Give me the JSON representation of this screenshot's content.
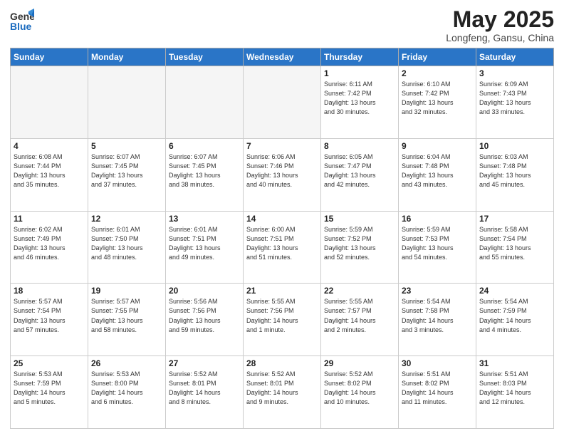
{
  "header": {
    "logo_general": "General",
    "logo_blue": "Blue",
    "month_title": "May 2025",
    "location": "Longfeng, Gansu, China"
  },
  "weekdays": [
    "Sunday",
    "Monday",
    "Tuesday",
    "Wednesday",
    "Thursday",
    "Friday",
    "Saturday"
  ],
  "weeks": [
    [
      {
        "day": "",
        "info": ""
      },
      {
        "day": "",
        "info": ""
      },
      {
        "day": "",
        "info": ""
      },
      {
        "day": "",
        "info": ""
      },
      {
        "day": "1",
        "info": "Sunrise: 6:11 AM\nSunset: 7:42 PM\nDaylight: 13 hours\nand 30 minutes."
      },
      {
        "day": "2",
        "info": "Sunrise: 6:10 AM\nSunset: 7:42 PM\nDaylight: 13 hours\nand 32 minutes."
      },
      {
        "day": "3",
        "info": "Sunrise: 6:09 AM\nSunset: 7:43 PM\nDaylight: 13 hours\nand 33 minutes."
      }
    ],
    [
      {
        "day": "4",
        "info": "Sunrise: 6:08 AM\nSunset: 7:44 PM\nDaylight: 13 hours\nand 35 minutes."
      },
      {
        "day": "5",
        "info": "Sunrise: 6:07 AM\nSunset: 7:45 PM\nDaylight: 13 hours\nand 37 minutes."
      },
      {
        "day": "6",
        "info": "Sunrise: 6:07 AM\nSunset: 7:45 PM\nDaylight: 13 hours\nand 38 minutes."
      },
      {
        "day": "7",
        "info": "Sunrise: 6:06 AM\nSunset: 7:46 PM\nDaylight: 13 hours\nand 40 minutes."
      },
      {
        "day": "8",
        "info": "Sunrise: 6:05 AM\nSunset: 7:47 PM\nDaylight: 13 hours\nand 42 minutes."
      },
      {
        "day": "9",
        "info": "Sunrise: 6:04 AM\nSunset: 7:48 PM\nDaylight: 13 hours\nand 43 minutes."
      },
      {
        "day": "10",
        "info": "Sunrise: 6:03 AM\nSunset: 7:48 PM\nDaylight: 13 hours\nand 45 minutes."
      }
    ],
    [
      {
        "day": "11",
        "info": "Sunrise: 6:02 AM\nSunset: 7:49 PM\nDaylight: 13 hours\nand 46 minutes."
      },
      {
        "day": "12",
        "info": "Sunrise: 6:01 AM\nSunset: 7:50 PM\nDaylight: 13 hours\nand 48 minutes."
      },
      {
        "day": "13",
        "info": "Sunrise: 6:01 AM\nSunset: 7:51 PM\nDaylight: 13 hours\nand 49 minutes."
      },
      {
        "day": "14",
        "info": "Sunrise: 6:00 AM\nSunset: 7:51 PM\nDaylight: 13 hours\nand 51 minutes."
      },
      {
        "day": "15",
        "info": "Sunrise: 5:59 AM\nSunset: 7:52 PM\nDaylight: 13 hours\nand 52 minutes."
      },
      {
        "day": "16",
        "info": "Sunrise: 5:59 AM\nSunset: 7:53 PM\nDaylight: 13 hours\nand 54 minutes."
      },
      {
        "day": "17",
        "info": "Sunrise: 5:58 AM\nSunset: 7:54 PM\nDaylight: 13 hours\nand 55 minutes."
      }
    ],
    [
      {
        "day": "18",
        "info": "Sunrise: 5:57 AM\nSunset: 7:54 PM\nDaylight: 13 hours\nand 57 minutes."
      },
      {
        "day": "19",
        "info": "Sunrise: 5:57 AM\nSunset: 7:55 PM\nDaylight: 13 hours\nand 58 minutes."
      },
      {
        "day": "20",
        "info": "Sunrise: 5:56 AM\nSunset: 7:56 PM\nDaylight: 13 hours\nand 59 minutes."
      },
      {
        "day": "21",
        "info": "Sunrise: 5:55 AM\nSunset: 7:56 PM\nDaylight: 14 hours\nand 1 minute."
      },
      {
        "day": "22",
        "info": "Sunrise: 5:55 AM\nSunset: 7:57 PM\nDaylight: 14 hours\nand 2 minutes."
      },
      {
        "day": "23",
        "info": "Sunrise: 5:54 AM\nSunset: 7:58 PM\nDaylight: 14 hours\nand 3 minutes."
      },
      {
        "day": "24",
        "info": "Sunrise: 5:54 AM\nSunset: 7:59 PM\nDaylight: 14 hours\nand 4 minutes."
      }
    ],
    [
      {
        "day": "25",
        "info": "Sunrise: 5:53 AM\nSunset: 7:59 PM\nDaylight: 14 hours\nand 5 minutes."
      },
      {
        "day": "26",
        "info": "Sunrise: 5:53 AM\nSunset: 8:00 PM\nDaylight: 14 hours\nand 6 minutes."
      },
      {
        "day": "27",
        "info": "Sunrise: 5:52 AM\nSunset: 8:01 PM\nDaylight: 14 hours\nand 8 minutes."
      },
      {
        "day": "28",
        "info": "Sunrise: 5:52 AM\nSunset: 8:01 PM\nDaylight: 14 hours\nand 9 minutes."
      },
      {
        "day": "29",
        "info": "Sunrise: 5:52 AM\nSunset: 8:02 PM\nDaylight: 14 hours\nand 10 minutes."
      },
      {
        "day": "30",
        "info": "Sunrise: 5:51 AM\nSunset: 8:02 PM\nDaylight: 14 hours\nand 11 minutes."
      },
      {
        "day": "31",
        "info": "Sunrise: 5:51 AM\nSunset: 8:03 PM\nDaylight: 14 hours\nand 12 minutes."
      }
    ]
  ]
}
